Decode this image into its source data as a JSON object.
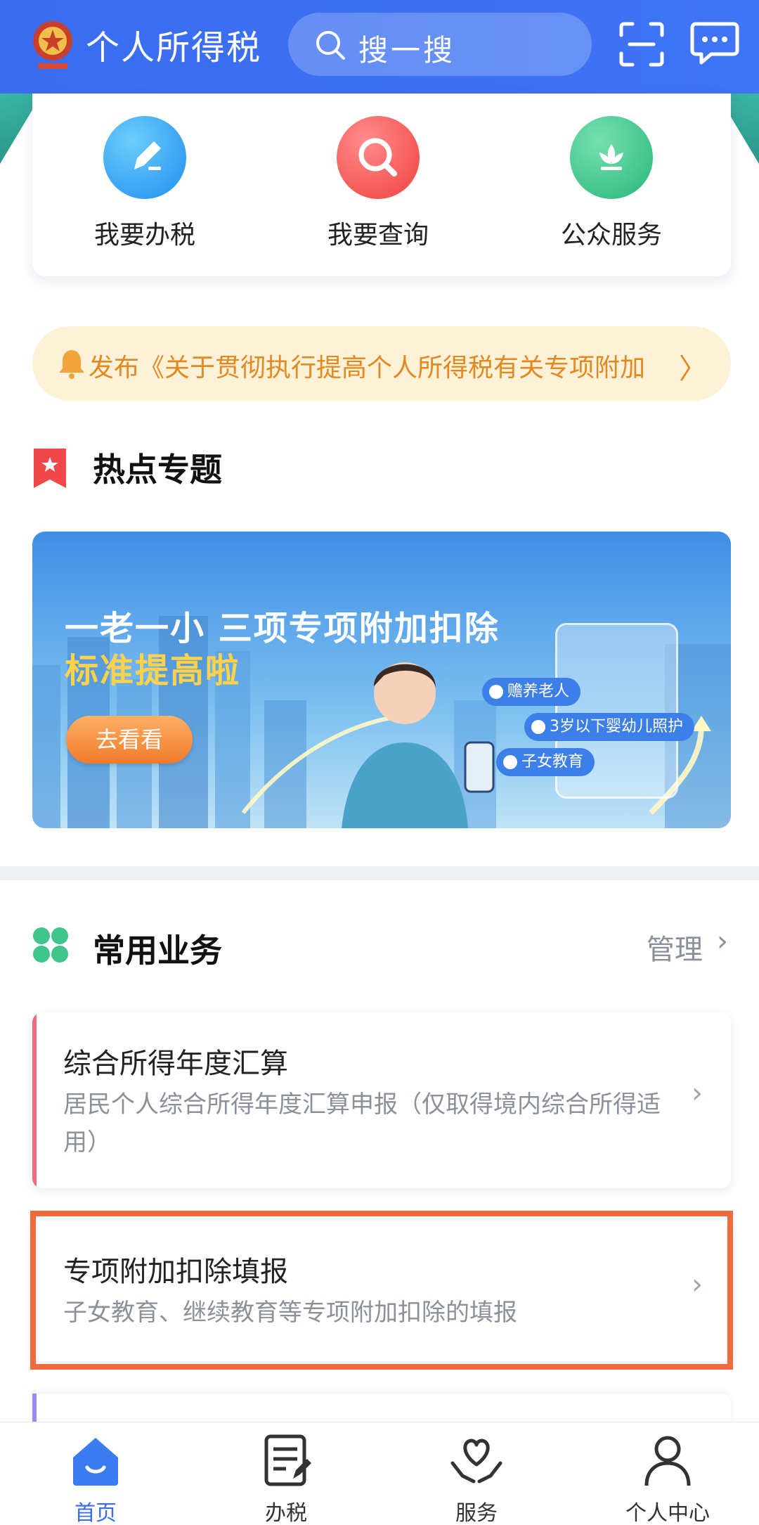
{
  "header": {
    "app_title": "个人所得税",
    "search_placeholder": "搜一搜"
  },
  "quick_actions": [
    {
      "label": "我要办税"
    },
    {
      "label": "我要查询"
    },
    {
      "label": "公众服务"
    }
  ],
  "notice": {
    "text": "发布《关于贯彻执行提高个人所得税有关专项附加"
  },
  "hot_topics": {
    "title": "热点专题",
    "banner": {
      "title": "一老一小 三项专项附加扣除",
      "subtitle": "标准提高啦",
      "button": "去看看",
      "tags": [
        "赡养老人",
        "3岁以下婴幼儿照护",
        "子女教育"
      ]
    }
  },
  "common_services": {
    "title": "常用业务",
    "manage_label": "管理",
    "items": [
      {
        "title": "综合所得年度汇算",
        "desc": "居民个人综合所得年度汇算申报（仅取得境内综合所得适用）",
        "accent": "#f06b7d"
      },
      {
        "title": "专项附加扣除填报",
        "desc": "子女教育、继续教育等专项附加扣除的填报",
        "accent": "#ffffff"
      }
    ]
  },
  "tabbar": {
    "items": [
      {
        "label": "首页",
        "active": true
      },
      {
        "label": "办税",
        "active": false
      },
      {
        "label": "服务",
        "active": false
      },
      {
        "label": "个人中心",
        "active": false
      }
    ]
  },
  "colors": {
    "brand_blue": "#3a6cf0",
    "highlight": "#ef6b3f",
    "notice_text": "#e2891f"
  }
}
